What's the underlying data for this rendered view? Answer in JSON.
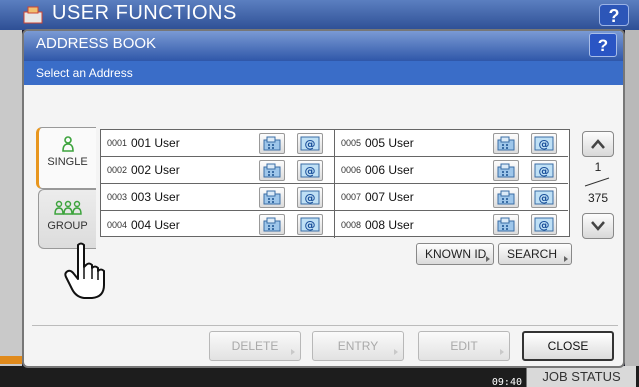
{
  "app": {
    "title": "USER FUNCTIONS",
    "help": "?"
  },
  "dialog": {
    "title": "ADDRESS BOOK",
    "help": "?",
    "subtitle": "Select an Address"
  },
  "tabs": [
    {
      "label": "SINGLE",
      "icon": "person-icon",
      "active": true
    },
    {
      "label": "GROUP",
      "icon": "people-group-icon",
      "active": false
    }
  ],
  "entries": [
    {
      "num": "0001",
      "name": "001 User"
    },
    {
      "num": "0002",
      "name": "002 User"
    },
    {
      "num": "0003",
      "name": "003 User"
    },
    {
      "num": "0004",
      "name": "004 User"
    },
    {
      "num": "0005",
      "name": "005 User"
    },
    {
      "num": "0006",
      "name": "006 User"
    },
    {
      "num": "0007",
      "name": "007 User"
    },
    {
      "num": "0008",
      "name": "008 User"
    }
  ],
  "pager": {
    "current": "1",
    "total": "375"
  },
  "actions": {
    "known_id": "KNOWN ID",
    "search": "SEARCH"
  },
  "footer_buttons": {
    "delete": "DELETE",
    "entry": "ENTRY",
    "edit": "EDIT",
    "close": "CLOSE"
  },
  "status": {
    "clock": "09:40",
    "job_status": "JOB STATUS"
  },
  "colors": {
    "title_bar": "#2f57a9",
    "subtitle_bar": "#3a6dc8",
    "tab_accent": "#e8961e",
    "icon_green": "#3ca33c"
  }
}
